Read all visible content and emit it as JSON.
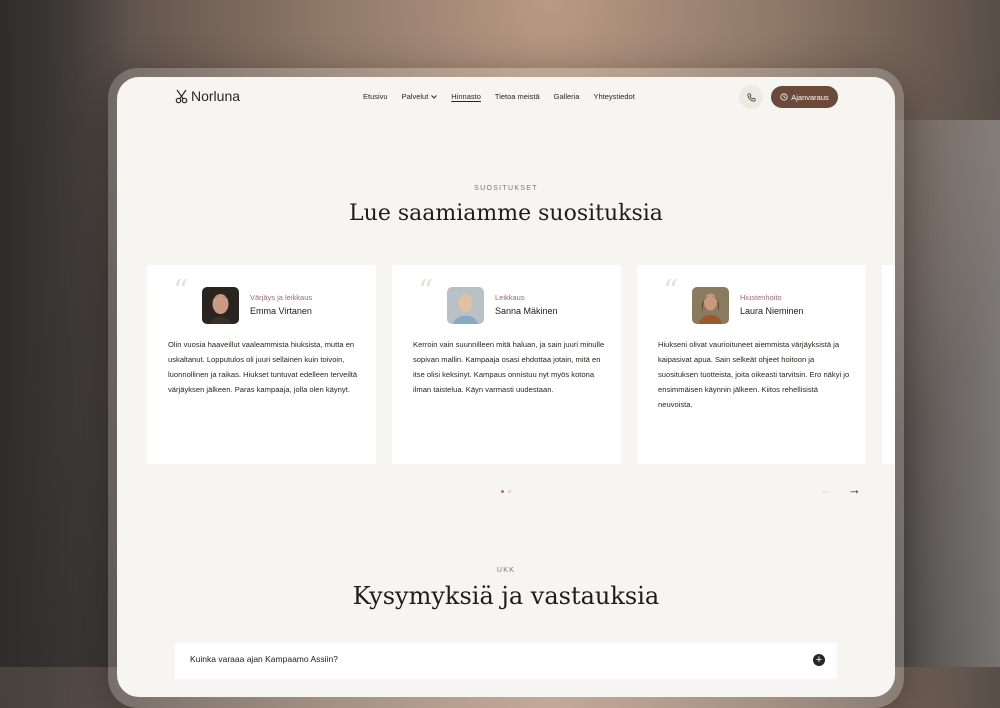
{
  "brand": {
    "name": "Norluna"
  },
  "nav": {
    "items": [
      "Etusivu",
      "Palvelut",
      "Hinnasto",
      "Tietoa meistä",
      "Galleria",
      "Yhteystiedot"
    ],
    "book_label": "Ajanvaraus"
  },
  "testimonials": {
    "eyebrow": "SUOSITUKSET",
    "title": "Lue saamiamme suosituksia",
    "cards": [
      {
        "service": "Värjäys ja leikkaus",
        "name": "Emma Virtanen",
        "text": "Olin vuosia haaveillut vaaleammista hiuksista, mutta en uskaltanut. Lopputulos oli juuri sellainen kuin toivoin, luonnollinen ja raikas. Hiukset tuntuvat edelleen terveiltä värjäyksen jälkeen. Paras kampaaja, jolla olen käynyt."
      },
      {
        "service": "Leikkaus",
        "name": "Sanna Mäkinen",
        "text": "Kerroin vain suunnilleen mitä haluan, ja sain juuri minulle sopivan mallin. Kampaaja osasi ehdottaa jotain, mitä en itse olisi keksinyt. Kampaus onnistuu nyt myös kotona ilman taistelua. Käyn varmasti uudestaan."
      },
      {
        "service": "Hiustenhoito",
        "name": "Laura Nieminen",
        "text": "Hiukseni olivat vaurioituneet aiemmista värjäyksistä ja kaipasivat apua. Sain selkeät ohjeet hoitoon ja suosituksen tuotteista, joita oikeasti tarvitsin. Ero näkyi jo ensimmäisen käynnin jälkeen. Kiitos rehellisistä neuvoista."
      }
    ]
  },
  "faq": {
    "eyebrow": "UKK",
    "title": "Kysymyksiä ja vastauksia",
    "first_question": "Kuinka varaaa ajan Kampaamo Assiin?"
  },
  "colors": {
    "accent": "#6b4a3a",
    "page_bg": "#f7f5f1",
    "service_text": "#9a6a78"
  }
}
